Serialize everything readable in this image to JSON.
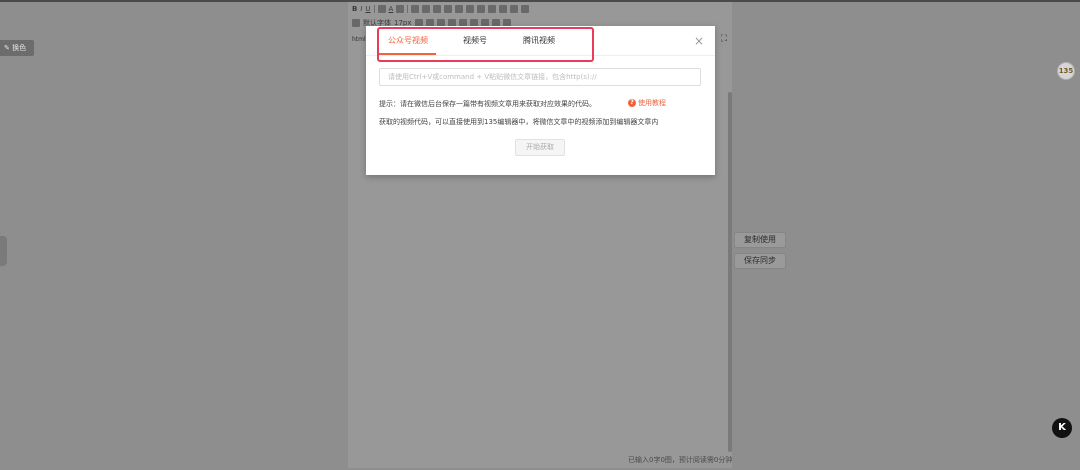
{
  "page": {
    "left_tag": "换色",
    "badge_135": "135",
    "badge_k": "K"
  },
  "toolbar": {
    "row1_text": [
      "U",
      "A"
    ],
    "font_family_label": "默认字体",
    "font_size_label": "17px",
    "html_tag": "html"
  },
  "sidebar": {
    "copy_button": "复制使用",
    "save_sync_button": "保存同步"
  },
  "status": {
    "word_count": "已输入0字0图，预计阅读需0分钟"
  },
  "modal": {
    "tabs": [
      {
        "label": "公众号视频",
        "active": true
      },
      {
        "label": "视频号",
        "active": false
      },
      {
        "label": "腾讯视频",
        "active": false
      }
    ],
    "close_symbol": "×",
    "input_placeholder": "请使用Ctrl+V或command + V粘贴微信文章链接，包含http(s)://",
    "input_value": "",
    "hint_text": "提示：请在微信后台保存一篇带有视频文章用来获取对应效果的代码。",
    "help_link": "使用教程",
    "help_icon_symbol": "?",
    "description": "获取的视频代码，可以直接使用到135编辑器中，将微信文章中的视频添加到编辑器文章内",
    "start_button": "开始获取"
  },
  "colors": {
    "accent": "#f0643c",
    "highlight": "#e83c5a"
  }
}
